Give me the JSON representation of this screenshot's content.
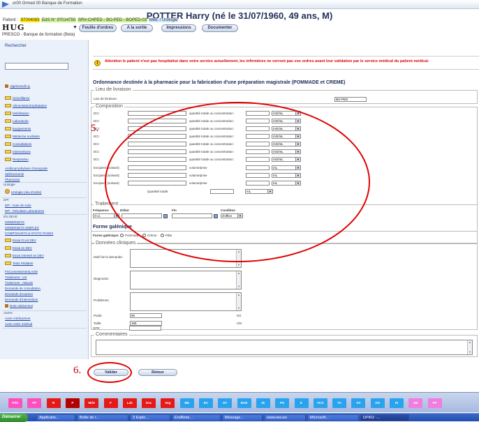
{
  "window": {
    "title": "or00 Ormed 00 Banque de Formation"
  },
  "patient": {
    "name": "POTTER Harry (né le 31/07/1960, 49 ans, M)",
    "label": "Patient : ",
    "id": "97004083",
    "eds": "EdS N° 97014750",
    "units": "SRV-CHPED - BO-PED - BOPED-03",
    "med": "Méd. / Urologie"
  },
  "app": {
    "logo": "HUG",
    "subtitle": "PRESCO - Banque de formation (Beta)"
  },
  "navtabs": [
    "Feuille d'ordres",
    "A la sortie",
    "Impressions",
    "Documenter"
  ],
  "sidebar": {
    "search_label": "Rechercher",
    "vigi": "Vigi/Gemelli",
    "items": [
      "Surveillance",
      "Alimentation/Hydratation",
      "Mobilisation",
      "Laboratoire",
      "Equipements",
      "Médecine nucléaire",
      "Consultations",
      "Interventions",
      "Respiration"
    ],
    "links": [
      "Antibioprophylaxie chirurgicale",
      "Splénectomie",
      "Pharmacie"
    ],
    "uro_head": "Urologie",
    "uro_item": "Urologie (Jeu d'ordre)",
    "dpi_head": "DPI",
    "dpi_items": [
      "DPI : Note de suite",
      "DPI : Résultats Laboratoires"
    ],
    "dev_head": "EN DEVE",
    "dev_links": [
      "ORDERSETS",
      "ORDERSETS SIMPLES",
      "COMPOSANTS & STATIC PAGES"
    ],
    "dev_items": [
      "Essai GI en DEV",
      "Essai en DEV",
      "Essai Orientel en DEV",
      "Tests Pédiatrie"
    ],
    "dev_links2": [
      "FSConsentementLAnM",
      "Traitement : US",
      "Traitement : Attitude",
      "Demande de consultation",
      "Demande d'examen",
      "Demande d'intervention"
    ],
    "drain": "Drain abdominal",
    "autres_head": "Autres",
    "autres": [
      "Autre médicament",
      "Autre ordre médical"
    ]
  },
  "warning": "Attention le patient n'est pas hospitalisé dans votre service actuellement, les infirmières ne verront pas vos ordres avant leur validation par le service médical du patient médical.",
  "form": {
    "title": "Ordonnance destinée à la pharmacie pour la fabrication d'une préparation magistrale (POMMADE et CREME)",
    "livraison": {
      "legend": "Lieu de livraison",
      "label": "Lieu de livraison:",
      "value": "BO-PED"
    },
    "composition": {
      "legend": "Composition",
      "dci_label": "DCI",
      "qty_label": "quantité totale ou concentration:",
      "unit_mg": "mG/mL",
      "excipient_label": "Excipient (solvant)",
      "vol_label": "volume/prise",
      "unit_ml": "mL",
      "total_label": "Quantité totale:",
      "total_unit": "mL"
    },
    "traitement": {
      "legend": "Traitement",
      "headers": [
        "Fréquence",
        "Début",
        "Fin",
        "Condition"
      ],
      "freq_value": "O.U.",
      "cond_value": "d'office"
    },
    "galenique": {
      "legend": "Forme galénique",
      "label": "Forme galénique:",
      "options": [
        "Pommade",
        "Crème",
        "Pâte"
      ]
    },
    "cliniques": {
      "legend": "Données cliniques",
      "motif": "Motif de la demande:",
      "diagnostic": "Diagnostic:",
      "problemes": "Problèmes:",
      "poids_label": "Poids:",
      "poids_value": "50",
      "poids_unit": "KG",
      "taille_label": "Taille:",
      "taille_value": "165",
      "taille_unit": "CM",
      "gfr_label": "GFR:"
    },
    "commentaires": {
      "legend": "Commentaires"
    },
    "buttons": {
      "valider": "Valider",
      "retour": "Retour"
    }
  },
  "annotations": {
    "five": "5.",
    "six": "6."
  },
  "categories": [
    {
      "label": "PdG",
      "color": "#ff4fbf"
    },
    {
      "label": "PP",
      "color": "#ff4fbf"
    },
    {
      "label": "R",
      "color": "#e61919"
    },
    {
      "label": "P",
      "color": "#b30000"
    },
    {
      "label": "MdS",
      "color": "#e61919"
    },
    {
      "label": "F",
      "color": "#e61919"
    },
    {
      "label": "Lab",
      "color": "#e61919"
    },
    {
      "label": "Doc",
      "color": "#e61919"
    },
    {
      "label": "Img",
      "color": "#e61919"
    },
    {
      "label": "BD",
      "color": "#2aa3ef"
    },
    {
      "label": "EC",
      "color": "#2aa3ef"
    },
    {
      "label": "DT",
      "color": "#2aa3ef"
    },
    {
      "label": "RAD",
      "color": "#2aa3ef"
    },
    {
      "label": "IG",
      "color": "#2aa3ef"
    },
    {
      "label": "PS",
      "color": "#2aa3ef"
    },
    {
      "label": "E",
      "color": "#2aa3ef"
    },
    {
      "label": "VCS",
      "color": "#2aa3ef"
    },
    {
      "label": "TC",
      "color": "#2aa3ef"
    },
    {
      "label": "SV",
      "color": "#2aa3ef"
    },
    {
      "label": "OS",
      "color": "#2aa3ef"
    },
    {
      "label": "IS",
      "color": "#2aa3ef"
    },
    {
      "label": "AD",
      "color": "#f07ee0"
    },
    {
      "label": "PV",
      "color": "#f07ee0"
    }
  ],
  "taskbar": {
    "start": "Démarrer",
    "items": [
      "Applicatio...",
      "Boîte de r...",
      "3 Explo...",
      "EndNote...",
      "Message...",
      "www.ww.ws",
      "Microsoft...",
      "DPIR2 -..."
    ]
  }
}
